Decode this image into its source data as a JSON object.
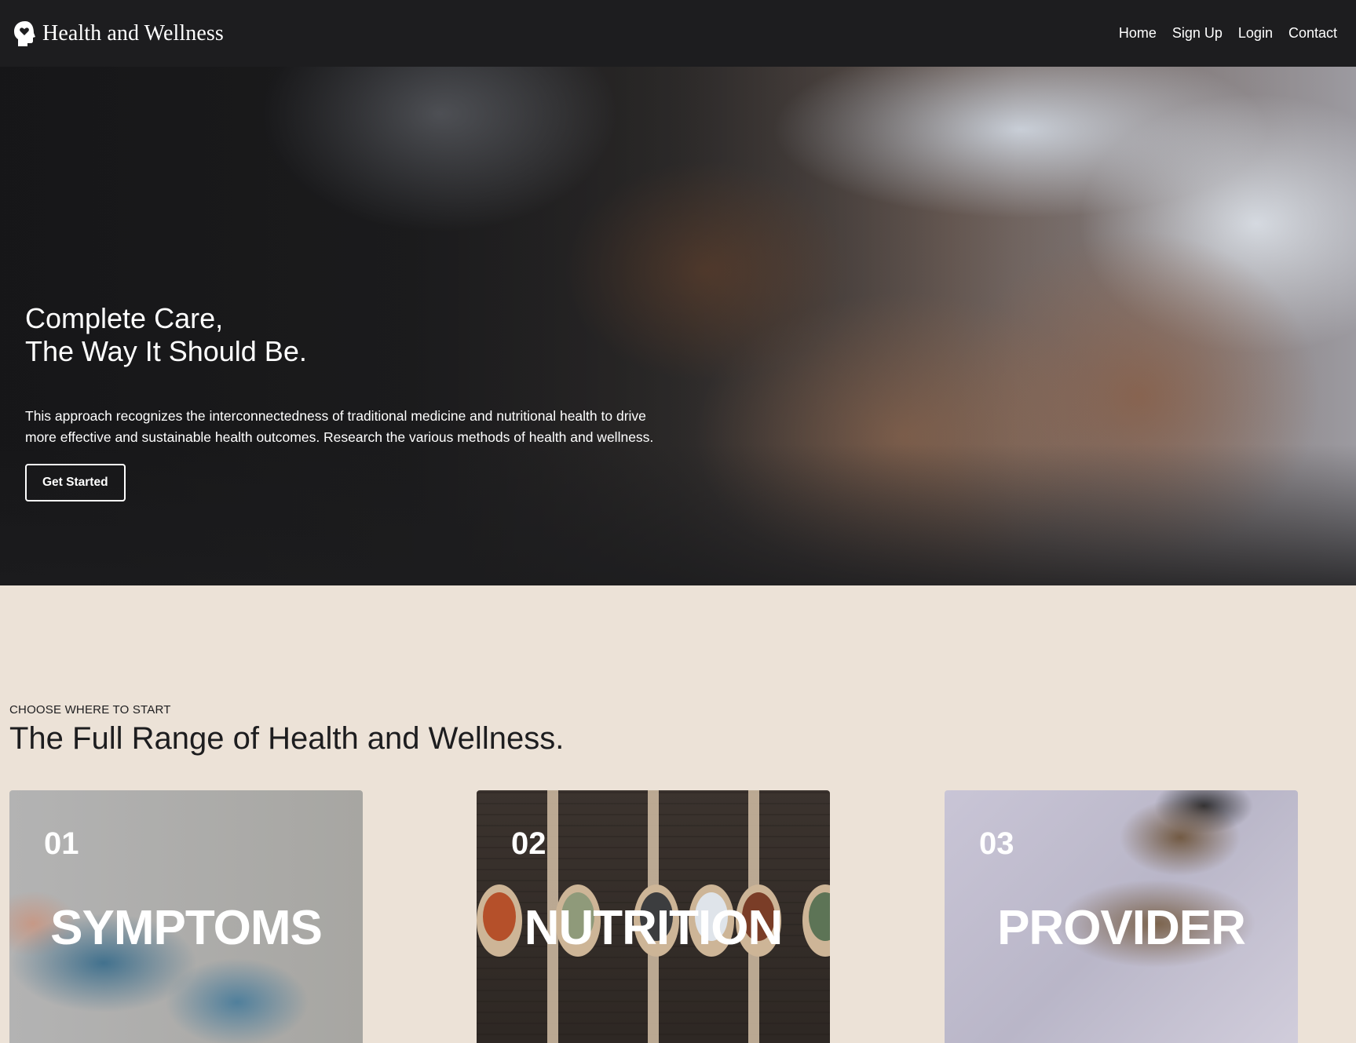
{
  "nav": {
    "brand": "Health and Wellness",
    "brand_icon": "head-heart-icon",
    "links": [
      "Home",
      "Sign Up",
      "Login",
      "Contact"
    ]
  },
  "hero": {
    "title_line1": "Complete Care,",
    "title_line2": "The Way It Should Be.",
    "text": "This approach recognizes the interconnectedness of traditional medicine and nutritional health to drive more effective and sustainable health outcomes. Research the various methods of health and wellness.",
    "button": "Get Started"
  },
  "section": {
    "eyebrow": "CHOOSE WHERE TO START",
    "title": "The Full Range of Health and Wellness."
  },
  "cards": [
    {
      "number": "01",
      "title": "SYMPTOMS"
    },
    {
      "number": "02",
      "title": "NUTRITION"
    },
    {
      "number": "03",
      "title": "PROVIDER"
    }
  ],
  "colors": {
    "nav_bg": "#1d1d1f",
    "page_bg": "#ece2d7",
    "text_dark": "#1d1d1f"
  }
}
